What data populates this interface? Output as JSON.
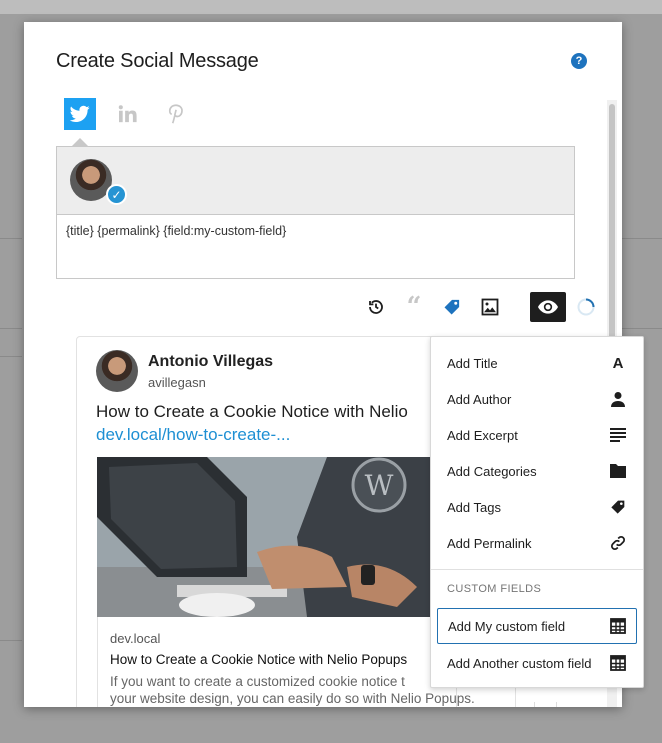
{
  "modal": {
    "title": "Create Social Message",
    "help_icon": "question-circle-icon"
  },
  "networks": [
    {
      "name": "twitter",
      "icon": "twitter-icon",
      "active": true
    },
    {
      "name": "linkedin",
      "icon": "linkedin-icon",
      "active": false
    },
    {
      "name": "pinterest",
      "icon": "pinterest-icon",
      "active": false
    }
  ],
  "editor": {
    "avatar": "profile-avatar",
    "text": "{title} {permalink} {field:my-custom-field}"
  },
  "toolbar": [
    "history-icon",
    "quote-icon",
    "tag-icon",
    "image-icon",
    "eye-icon",
    "spinner-icon"
  ],
  "preview": {
    "author": "Antonio Villegas",
    "handle": "avillegasn",
    "text": "How to Create a Cookie Notice with Nelio",
    "link": "dev.local/how-to-create-...",
    "card": {
      "domain": "dev.local",
      "title": "How to Create a Cookie Notice with Nelio Popups",
      "description_line1": "If you want to create a customized cookie notice t",
      "description_line2": "your website design, you can easily do so with Nelio Popups."
    }
  },
  "dropdown": {
    "items": [
      {
        "label": "Add Title",
        "icon": "title-icon",
        "glyph": "A"
      },
      {
        "label": "Add Author",
        "icon": "author-icon"
      },
      {
        "label": "Add Excerpt",
        "icon": "excerpt-icon"
      },
      {
        "label": "Add Categories",
        "icon": "folder-icon"
      },
      {
        "label": "Add Tags",
        "icon": "tag-icon"
      },
      {
        "label": "Add Permalink",
        "icon": "link-icon"
      }
    ],
    "section_label": "CUSTOM FIELDS",
    "custom_fields": [
      {
        "label": "Add My custom field",
        "icon": "table-icon",
        "focused": true
      },
      {
        "label": "Add Another custom field",
        "icon": "table-icon",
        "focused": false
      }
    ]
  },
  "colors": {
    "twitter": "#1da1f2",
    "link": "#1d8fd3",
    "focus": "#2271b1",
    "tag_icon": "#1e73be"
  }
}
